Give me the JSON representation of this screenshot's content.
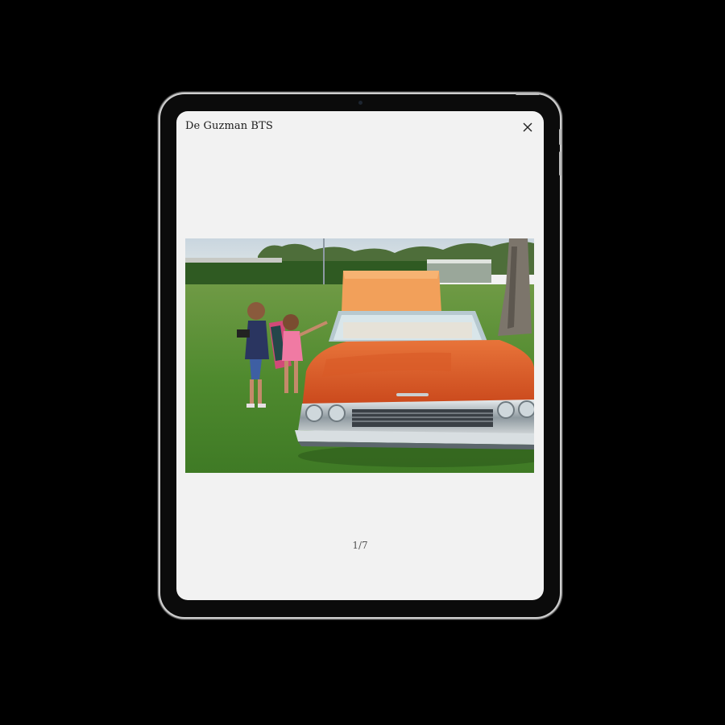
{
  "gallery": {
    "title": "De Guzman BTS",
    "counter": "1/7",
    "current_index": 1,
    "total": 7
  },
  "icons": {
    "close": "close-icon"
  },
  "photo": {
    "subject": "two girls beside an orange convertible lowrider on grass"
  },
  "colors": {
    "screen_bg": "#f2f2f2",
    "device_bezel": "#0b0b0b",
    "car_orange": "#e2622a"
  }
}
